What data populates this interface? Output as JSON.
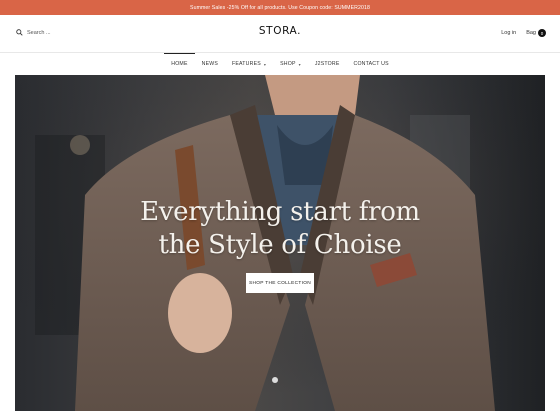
{
  "promo": {
    "text": "Summer Sales -25% Off for all products. Use Coupon code: SUMMER2018"
  },
  "header": {
    "search_placeholder": "Search ...",
    "logo": "STORA.",
    "login_label": "Log in",
    "bag_label": "Bag",
    "bag_count": "0"
  },
  "nav": {
    "items": [
      {
        "label": "HOME",
        "active": true
      },
      {
        "label": "NEWS"
      },
      {
        "label": "FEATURES",
        "dropdown": true
      },
      {
        "label": "SHOP",
        "dropdown": true
      },
      {
        "label": "J2STORE"
      },
      {
        "label": "CONTACT US"
      }
    ]
  },
  "hero": {
    "title_line1": "Everything start from",
    "title_line2": "the Style of Choise",
    "button_label": "SHOP THE COLLECTION"
  },
  "colors": {
    "promo_bg": "#d96547",
    "text": "#222222"
  },
  "icons": {
    "search": "search-icon",
    "bag": "bag-icon",
    "dropdown": "chevron-down-icon"
  }
}
